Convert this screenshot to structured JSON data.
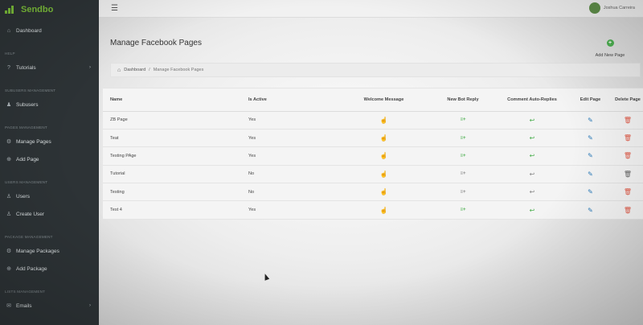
{
  "brand": {
    "name": "Sendbo"
  },
  "sidebar": {
    "dashboard": {
      "label": "Dashboard",
      "icon": "home-icon"
    },
    "section_help": "HELP",
    "tutorials": {
      "label": "Tutorials",
      "icon": "help-icon"
    },
    "section_subusers": "SUBUSERS MANAGEMENT",
    "subusers": {
      "label": "Subusers",
      "icon": "users-icon"
    },
    "section_pages": "PAGES MANAGEMENT",
    "manage_pages": {
      "label": "Manage Pages",
      "icon": "gear-icon"
    },
    "add_page": {
      "label": "Add Page",
      "icon": "add-icon"
    },
    "section_users": "USERS MANAGEMENT",
    "users": {
      "label": "Users",
      "icon": "user-icon"
    },
    "create_user": {
      "label": "Create User",
      "icon": "user-plus-icon"
    },
    "section_package": "PACKAGE MANAGEMENT",
    "manage_packages": {
      "label": "Manage Packages",
      "icon": "gear-icon"
    },
    "add_package": {
      "label": "Add Package",
      "icon": "add-icon"
    },
    "section_lists": "LISTS MANAGEMENT",
    "emails": {
      "label": "Emails",
      "icon": "mail-icon"
    }
  },
  "topbar": {
    "user_name": "Joshua Carreira"
  },
  "page": {
    "title": "Manage Facebook Pages",
    "add_new_label": "Add New Page"
  },
  "breadcrumb": {
    "home": "Dashboard",
    "separator": "/",
    "current": "Manage Facebook Pages"
  },
  "table": {
    "headers": {
      "name": "Name",
      "is_active": "Is Active",
      "welcome": "Welcome Message",
      "bot": "New Bot Reply",
      "comment": "Comment Auto-Replies",
      "edit": "Edit Page",
      "delete": "Delete Page"
    },
    "rows": [
      {
        "name": "ZB Page",
        "active": "Yes"
      },
      {
        "name": "Teat",
        "active": "Yes"
      },
      {
        "name": "Testing PAge",
        "active": "Yes"
      },
      {
        "name": "Tutorial",
        "active": "No"
      },
      {
        "name": "Testing",
        "active": "No"
      },
      {
        "name": "Test 4",
        "active": "Yes"
      }
    ]
  },
  "colors": {
    "sidebar_bg": "#2d3336",
    "brand_green": "#7cbf3a",
    "active_green": "#4caf50",
    "edit_blue": "#2b7bb9",
    "delete_red": "#e05a47"
  }
}
